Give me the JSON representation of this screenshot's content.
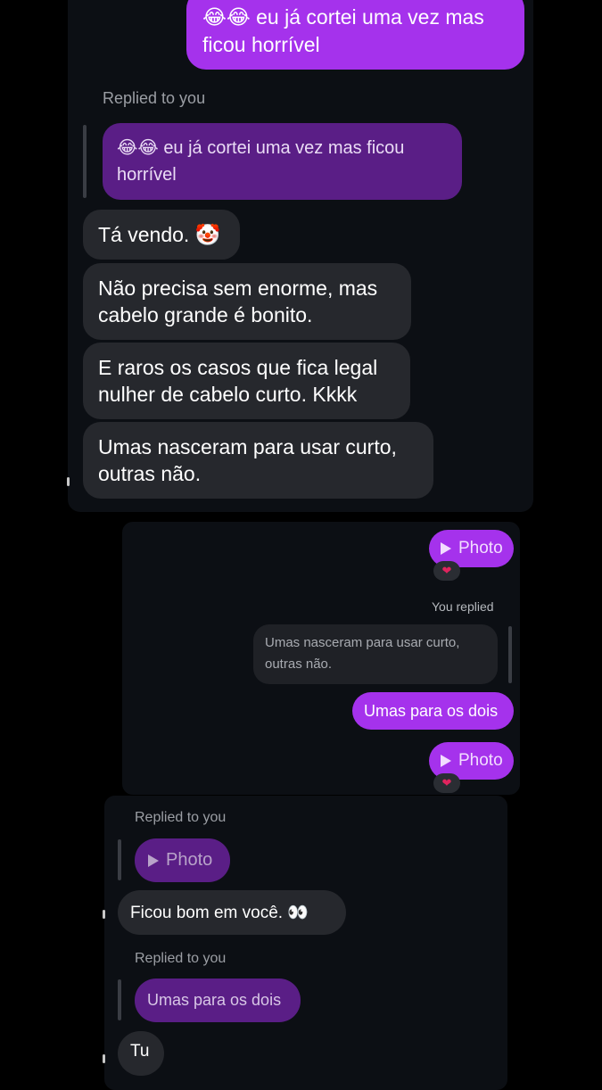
{
  "panel1": {
    "top_message": {
      "emoji": "😂😂",
      "text": "eu já cortei uma vez mas ficou horrível"
    },
    "replied_label": "Replied to you",
    "quoted_message": {
      "emoji": "😂😂",
      "text": "eu já cortei uma vez mas ficou horrível"
    },
    "incoming": [
      {
        "text": "Tá vendo.",
        "emoji": "🤡"
      },
      {
        "text": "Não precisa sem enorme, mas cabelo grande é bonito."
      },
      {
        "text": "E raros os casos que fica legal nulher de cabelo curto. Kkkk"
      },
      {
        "text": "Umas nasceram para usar curto, outras não."
      }
    ]
  },
  "panel2": {
    "photo_label": "Photo",
    "reaction": "❤",
    "you_replied_label": "You replied",
    "quoted_text": "Umas nasceram para usar curto, outras não.",
    "reply_text": "Umas para os dois",
    "photo_label_2": "Photo",
    "reaction_2": "❤"
  },
  "panel3": {
    "replied_label_1": "Replied to you",
    "quoted_photo_label": "Photo",
    "message_1": {
      "text": "Ficou bom em você.",
      "emoji": "👀"
    },
    "replied_label_2": "Replied to you",
    "quoted_text_2": "Umas para os dois",
    "message_2": "Tu"
  },
  "colors": {
    "outgoing": "#a532ec",
    "quoted": "#5a1e86",
    "incoming": "#26282d",
    "panel": "#0c0f14",
    "background": "#000000",
    "reaction": "#e0245e"
  },
  "icons": [
    "play-icon",
    "heart-icon"
  ]
}
